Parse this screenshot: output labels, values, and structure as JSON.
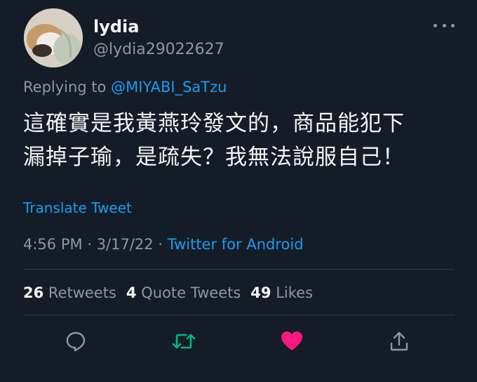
{
  "user": {
    "display_name": "lydia",
    "handle": "@lydia29022627"
  },
  "reply": {
    "prefix": "Replying to",
    "mention": "@MIYABI_SaTzu"
  },
  "tweet": {
    "text_line1": "這確實是我黃燕玲發文的，商品能犯下",
    "text_line2": "漏掉子瑜，是疏失？我無法說服自己！",
    "translate_label": "Translate Tweet",
    "time": "4:56 PM",
    "date": "3/17/22",
    "separator": "·",
    "source": "Twitter for Android"
  },
  "stats": {
    "retweets_count": "26",
    "retweets_label": "Retweets",
    "quotes_count": "4",
    "quotes_label": "Quote Tweets",
    "likes_count": "49",
    "likes_label": "Likes"
  },
  "colors": {
    "background": "#141d27",
    "accent": "#1d9bf0",
    "retweet": "#00ba7c",
    "like": "#f91880",
    "muted": "#8b98a5"
  },
  "icons": {
    "more": "more-horizontal-icon",
    "reply": "reply-bubble-icon",
    "retweet": "retweet-icon",
    "like": "heart-icon",
    "share": "share-icon"
  }
}
